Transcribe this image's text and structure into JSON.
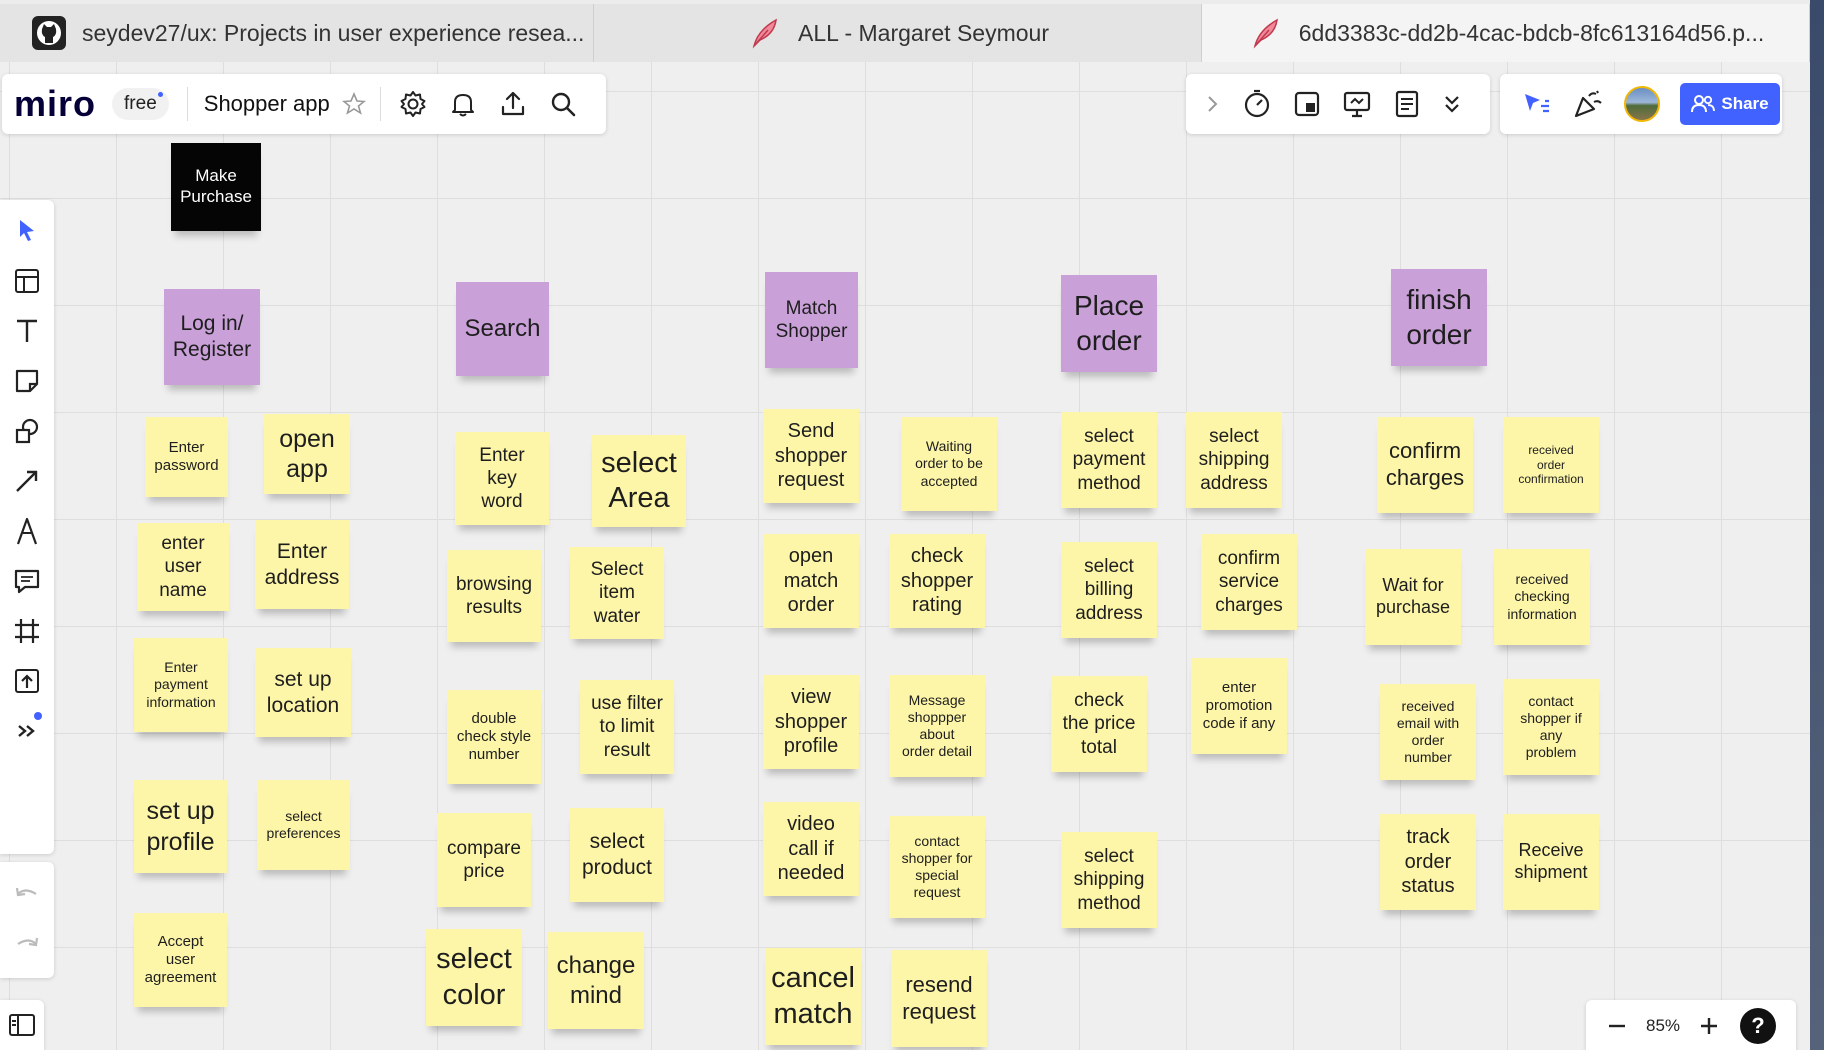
{
  "tabs": [
    {
      "title": "seydev27/ux: Projects in user experience resea...",
      "icon": "github-icon"
    },
    {
      "title": "ALL - Margaret Seymour",
      "icon": "feather-icon"
    },
    {
      "title": "6dd3383c-dd2b-4cac-bdcb-8fc613164d56.p...",
      "icon": "feather-icon"
    }
  ],
  "toolbar": {
    "logo": "miro",
    "plan": "free",
    "board_name": "Shopper app",
    "share_label": "Share",
    "zoom": "85%",
    "help": "?"
  },
  "colors": {
    "accent": "#4262ff",
    "yellow_sticky": "#fdf6a8",
    "purple_sticky": "#c9a0d8",
    "dark_sticky": "#050505"
  },
  "stickies": [
    {
      "text": "Make\nPurchase",
      "color": "dark"
    },
    {
      "text": "Log in/\nRegister",
      "color": "purple"
    },
    {
      "text": "Search",
      "color": "purple"
    },
    {
      "text": "Match\nShopper",
      "color": "purple"
    },
    {
      "text": "Place\norder",
      "color": "purple"
    },
    {
      "text": "finish\norder",
      "color": "purple"
    },
    {
      "text": "Enter\npassword",
      "color": "yellow"
    },
    {
      "text": "open\napp",
      "color": "yellow"
    },
    {
      "text": "enter\nuser\nname",
      "color": "yellow"
    },
    {
      "text": "Enter\naddress",
      "color": "yellow"
    },
    {
      "text": "Enter\npayment\ninformation",
      "color": "yellow"
    },
    {
      "text": "set up\nlocation",
      "color": "yellow"
    },
    {
      "text": "set up\nprofile",
      "color": "yellow"
    },
    {
      "text": "select\npreferences",
      "color": "yellow"
    },
    {
      "text": "Accept\nuser\nagreement",
      "color": "yellow"
    },
    {
      "text": "Enter\nkey\nword",
      "color": "yellow"
    },
    {
      "text": "select\nArea",
      "color": "yellow"
    },
    {
      "text": "browsing\nresults",
      "color": "yellow"
    },
    {
      "text": "Select\nitem\nwater",
      "color": "yellow"
    },
    {
      "text": "double\ncheck style\nnumber",
      "color": "yellow"
    },
    {
      "text": "use filter\nto limit\nresult",
      "color": "yellow"
    },
    {
      "text": "compare\nprice",
      "color": "yellow"
    },
    {
      "text": "select\nproduct",
      "color": "yellow"
    },
    {
      "text": "select\ncolor",
      "color": "yellow"
    },
    {
      "text": "change\nmind",
      "color": "yellow"
    },
    {
      "text": "Send\nshopper\nrequest",
      "color": "yellow"
    },
    {
      "text": "Waiting\norder to be\naccepted",
      "color": "yellow"
    },
    {
      "text": "open\nmatch\norder",
      "color": "yellow"
    },
    {
      "text": "check\nshopper\nrating",
      "color": "yellow"
    },
    {
      "text": "view\nshopper\nprofile",
      "color": "yellow"
    },
    {
      "text": "Message\nshoppper\nabout\norder detail",
      "color": "yellow"
    },
    {
      "text": "video\ncall if\nneeded",
      "color": "yellow"
    },
    {
      "text": "contact\nshopper for\nspecial\nrequest",
      "color": "yellow"
    },
    {
      "text": "cancel\nmatch",
      "color": "yellow"
    },
    {
      "text": "resend\nrequest",
      "color": "yellow"
    },
    {
      "text": "select\npayment\nmethod",
      "color": "yellow"
    },
    {
      "text": "select\nshipping\naddress",
      "color": "yellow"
    },
    {
      "text": "select\nbilling\naddress",
      "color": "yellow"
    },
    {
      "text": "confirm\nservice\ncharges",
      "color": "yellow"
    },
    {
      "text": "check\nthe price\ntotal",
      "color": "yellow"
    },
    {
      "text": "enter\npromotion\ncode if any",
      "color": "yellow"
    },
    {
      "text": "select\nshipping\nmethod",
      "color": "yellow"
    },
    {
      "text": "confirm\ncharges",
      "color": "yellow"
    },
    {
      "text": "received\norder\nconfirmation",
      "color": "yellow"
    },
    {
      "text": "Wait for\npurchase",
      "color": "yellow"
    },
    {
      "text": "received\nchecking\ninformation",
      "color": "yellow"
    },
    {
      "text": "received\nemail with\norder\nnumber",
      "color": "yellow"
    },
    {
      "text": "contact\nshopper if\nany\nproblem",
      "color": "yellow"
    },
    {
      "text": "track\norder\nstatus",
      "color": "yellow"
    },
    {
      "text": "Receive\nshipment",
      "color": "yellow"
    }
  ]
}
